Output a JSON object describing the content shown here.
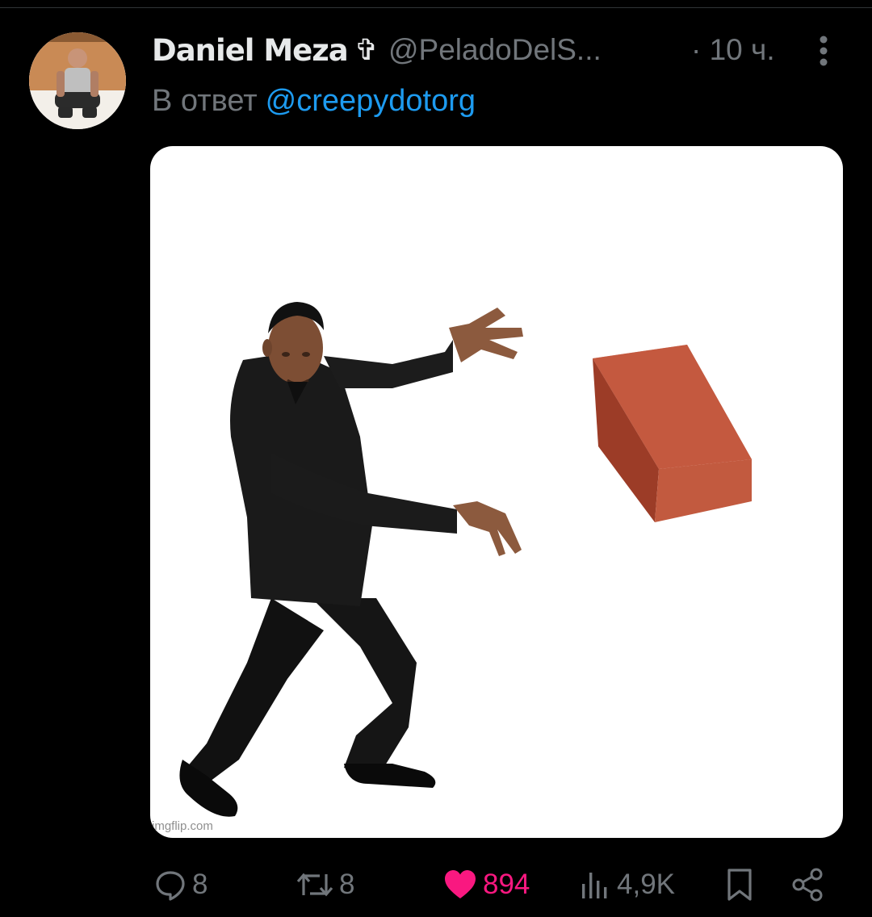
{
  "tweet": {
    "author": {
      "display_name": "Daniel Meza",
      "badge_glyph": "✞",
      "handle": "@PeladoDelS...",
      "avatar_icon": "avatar-photo"
    },
    "time": "· 10 ч.",
    "reply": {
      "prefix": "В ответ",
      "mention": "@creepydotorg"
    },
    "media": {
      "watermark": "imgflip.com",
      "brick_color": "#c8553a"
    },
    "actions": {
      "replies": "8",
      "reposts": "8",
      "likes": "894",
      "views": "4,9K"
    }
  },
  "colors": {
    "background": "#000000",
    "primary_text": "#e7e9ea",
    "secondary_text": "#71767b",
    "accent": "#1d9bf0",
    "like": "#f91880"
  }
}
